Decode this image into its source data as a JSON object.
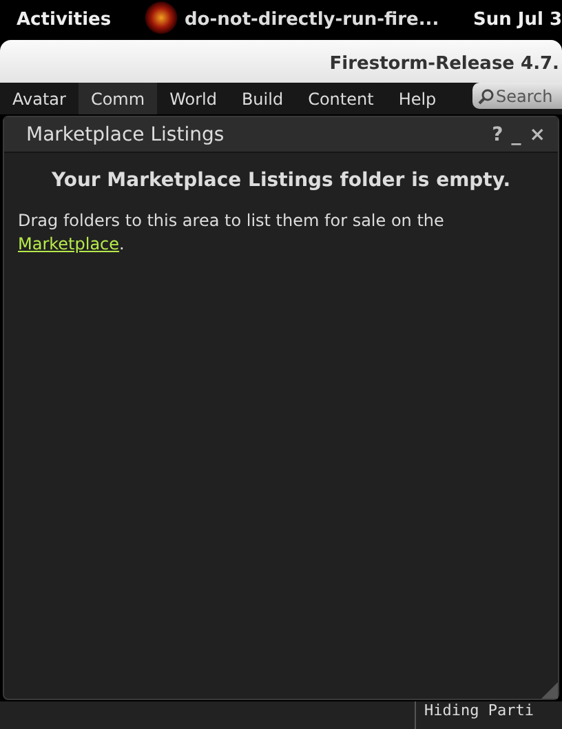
{
  "top_bar": {
    "activities": "Activities",
    "app_name": "do-not-directly-run-fire...",
    "clock": "Sun Jul 3"
  },
  "window": {
    "title": "Firestorm-Release 4.7."
  },
  "menu": [
    {
      "label": "Avatar",
      "selected": false
    },
    {
      "label": "Comm",
      "selected": true
    },
    {
      "label": "World",
      "selected": false
    },
    {
      "label": "Build",
      "selected": false
    },
    {
      "label": "Content",
      "selected": false
    },
    {
      "label": "Help",
      "selected": false
    }
  ],
  "search": {
    "placeholder": "Search"
  },
  "floater": {
    "title": "Marketplace Listings",
    "buttons": [
      "?",
      "_",
      "×"
    ],
    "heading": "Your Marketplace Listings folder is empty.",
    "message": "Drag folders to this area to list them for sale on the ",
    "link": "Marketplace",
    "after_link": "."
  },
  "status_bar": {
    "text": "Hiding Parti"
  }
}
